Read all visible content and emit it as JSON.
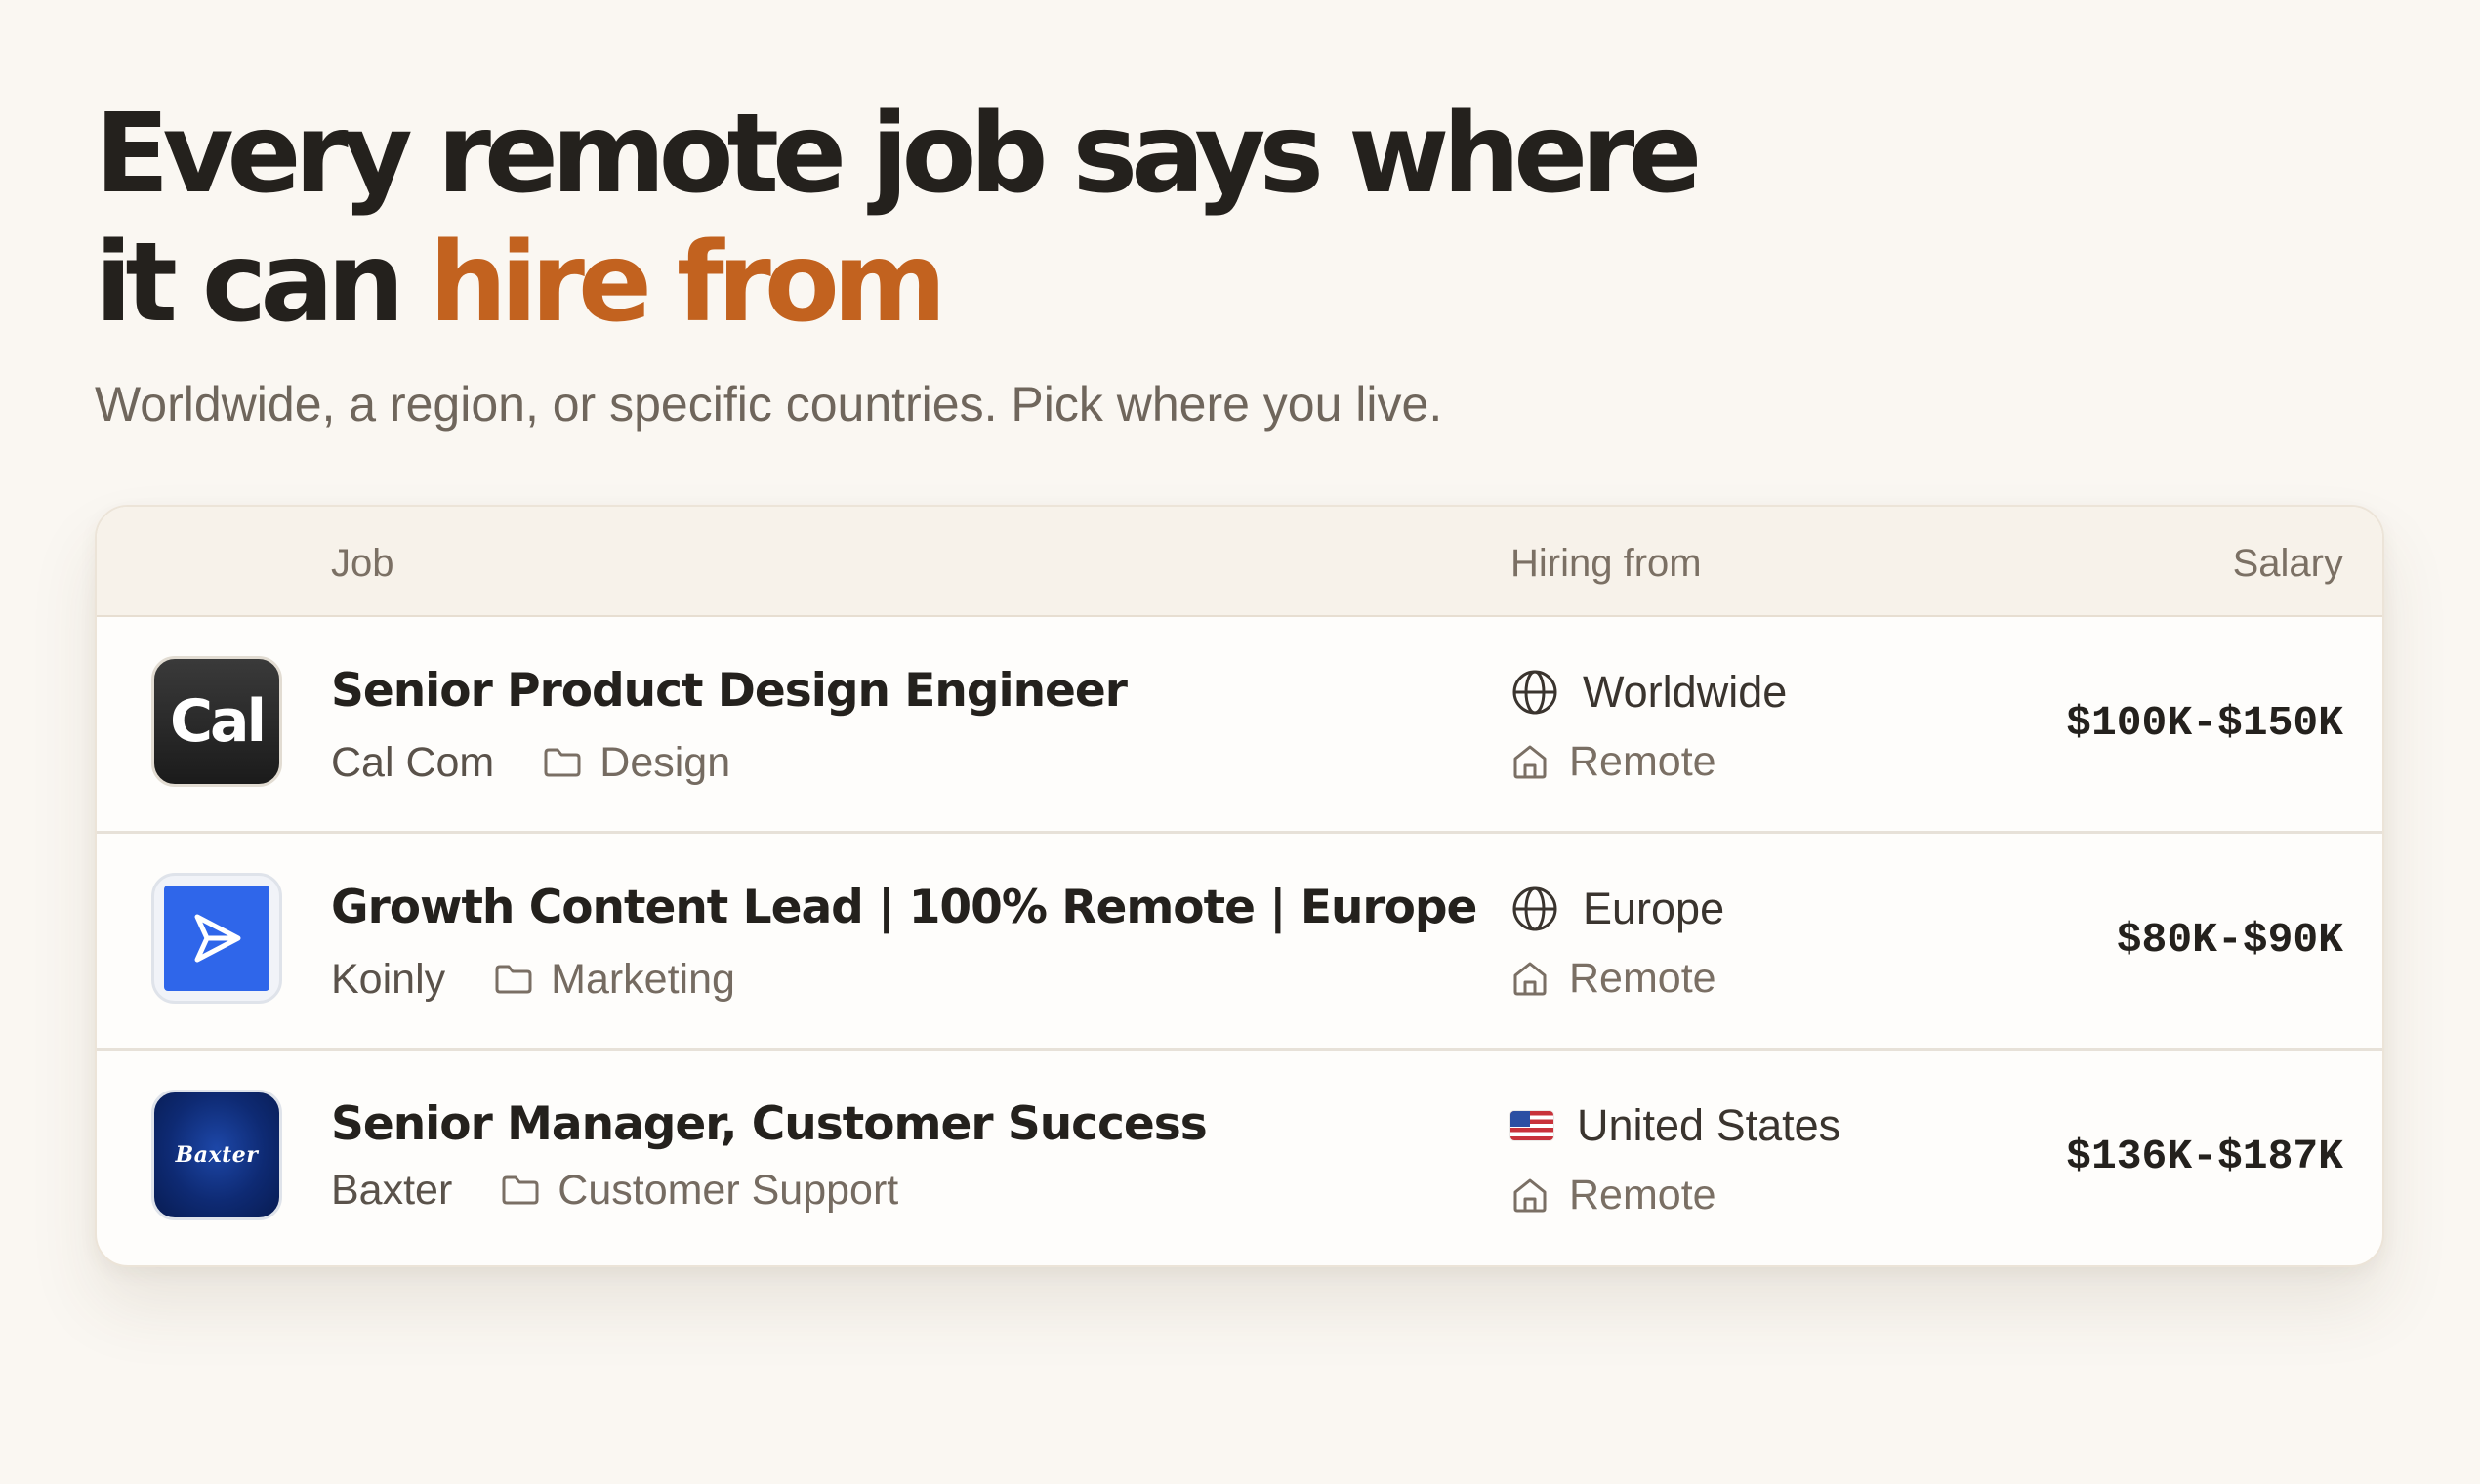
{
  "hero": {
    "headline_line1": "Every remote job says where",
    "headline_line2_prefix": "it can ",
    "headline_line2_accent": "hire from",
    "subtitle": "Worldwide, a region, or specific countries. Pick where you live."
  },
  "table": {
    "headers": {
      "job": "Job",
      "hiring_from": "Hiring from",
      "salary": "Salary"
    },
    "rows": [
      {
        "logo_text": "Cal",
        "title": "Senior Product Design Engineer",
        "company": "Cal Com",
        "category": "Design",
        "location": "Worldwide",
        "location_icon": "globe-icon",
        "work_type": "Remote",
        "salary": "$100K-$150K"
      },
      {
        "logo_text": "",
        "title": "Growth Content Lead | 100% Remote | Europe",
        "company": "Koinly",
        "category": "Marketing",
        "location": "Europe",
        "location_icon": "globe-icon",
        "work_type": "Remote",
        "salary": "$80K-$90K"
      },
      {
        "logo_text": "Baxter",
        "title": "Senior Manager, Customer Success",
        "company": "Baxter",
        "category": "Customer Support",
        "location": "United States",
        "location_icon": "us-flag-icon",
        "work_type": "Remote",
        "salary": "$136K-$187K"
      }
    ]
  },
  "colors": {
    "background": "#faf7f2",
    "accent": "#c2621f",
    "text": "#24211d",
    "muted": "#6f665c"
  }
}
